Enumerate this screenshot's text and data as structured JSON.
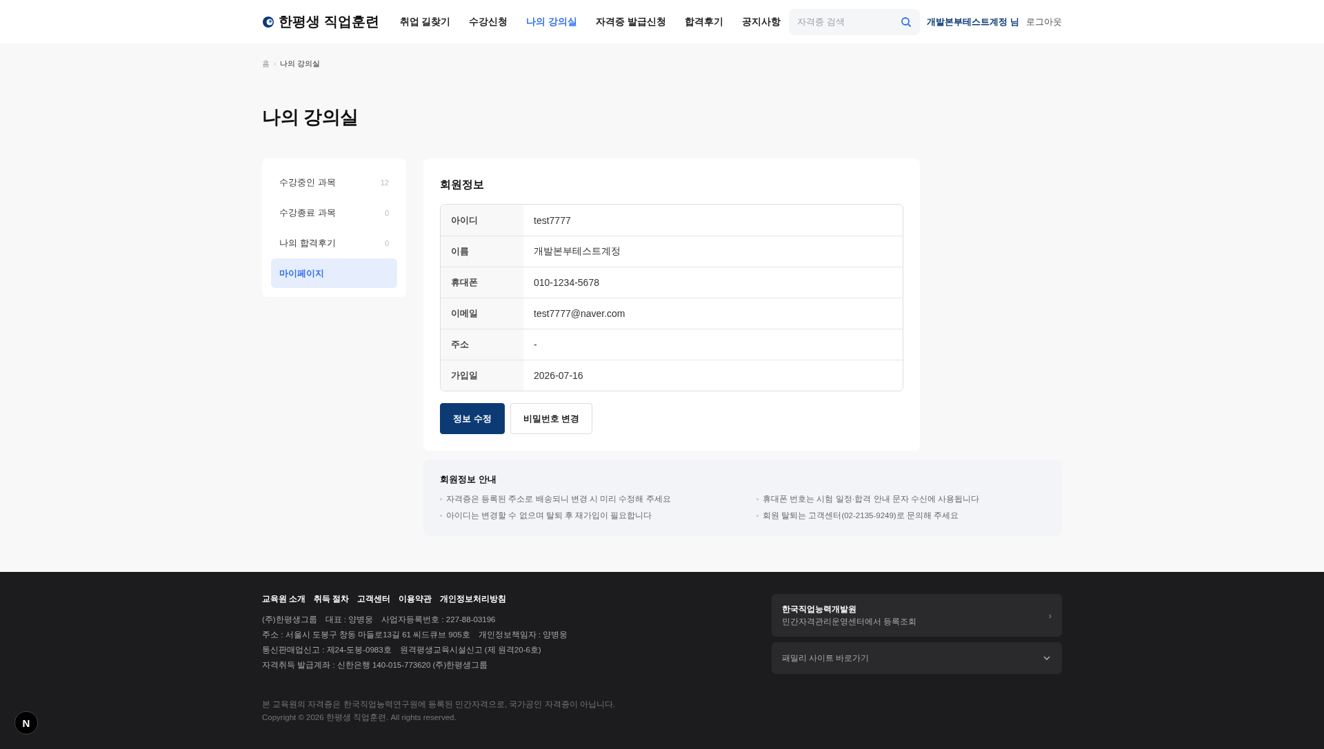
{
  "header": {
    "logo": "한평생 직업훈련",
    "nav": [
      {
        "label": "취업 길찾기",
        "selected": false
      },
      {
        "label": "수강신청",
        "selected": false
      },
      {
        "label": "나의 강의실",
        "selected": true
      },
      {
        "label": "자격증 발급신청",
        "selected": false
      },
      {
        "label": "합격후기",
        "selected": false
      },
      {
        "label": "공지사항",
        "selected": false
      }
    ],
    "search": {
      "placeholder": "자격증 검색"
    },
    "user": "개발본부테스트계정 님",
    "logout": "로그아웃"
  },
  "breadcrumb": [
    "홈",
    "나의 강의실"
  ],
  "page_title": "나의 강의실",
  "sidebar": {
    "items": [
      {
        "label": "수강중인 과목",
        "count": "12",
        "selected": false
      },
      {
        "label": "수강종료 과목",
        "count": "0",
        "selected": false
      },
      {
        "label": "나의 합격후기",
        "count": "0",
        "selected": false
      },
      {
        "label": "마이페이지",
        "selected": true
      }
    ]
  },
  "member_info": {
    "title": "회원정보",
    "rows": [
      {
        "label": "아이디",
        "value": "test7777"
      },
      {
        "label": "이름",
        "value": "개발본부테스트계정"
      },
      {
        "label": "휴대폰",
        "value": "010-1234-5678"
      },
      {
        "label": "이메일",
        "value": "test7777@naver.com"
      },
      {
        "label": "주소",
        "value": "-"
      },
      {
        "label": "가입일",
        "value": "2026-07-16"
      }
    ],
    "buttons": [
      {
        "label": "정보 수정",
        "kind": "primary"
      },
      {
        "label": "비밀번호 변경",
        "kind": "secondary"
      }
    ]
  },
  "notice": {
    "title": "회원정보 안내",
    "items": [
      "자격증은 등록된 주소로 배송되니 변경 시 미리 수정해 주세요",
      "휴대폰 번호는 시험 일정·합격 안내 문자 수신에 사용됩니다",
      "아이디는 변경할 수 없으며 탈퇴 후 재가입이 필요합니다",
      "회원 탈퇴는 고객센터(02-2135-9249)로 문의해 주세요"
    ]
  },
  "footer": {
    "links": [
      "교육원 소개",
      "취득 절차",
      "고객센터",
      "이용약관",
      "개인정보처리방침"
    ],
    "lines": [
      [
        "(주)한평생그룹",
        "대표 : 양병웅",
        "사업자등록번호 : 227-88-03196"
      ],
      [
        "주소 : 서울시 도봉구 창동 마들로13길 61 씨드큐브 905호",
        "개인정보책임자 : 양병웅"
      ],
      [
        "통신판매업신고 : 제24-도봉-0983호",
        "원격평생교육시설신고 (제 원격20-6호)"
      ],
      [
        "자격취득 발급계좌 : 신한은행 140-015-773620 (주)한평생그룹"
      ]
    ],
    "disclaimer": "본 교육원의 자격증은 한국직업능력연구원에 등록된 민간자격으로, 국가공인 자격증이 아닙니다.",
    "copyright": "Copyright © 2026 한평생 직업훈련. All rights reserved.",
    "org_card": {
      "title": "한국직업능력개발원",
      "subtitle": "민간자격관리운영센터에서 등록조회",
      "arrow": "›"
    },
    "family_select": {
      "label": "패밀리 사이트 바로가기"
    }
  },
  "dev_badge": "N"
}
